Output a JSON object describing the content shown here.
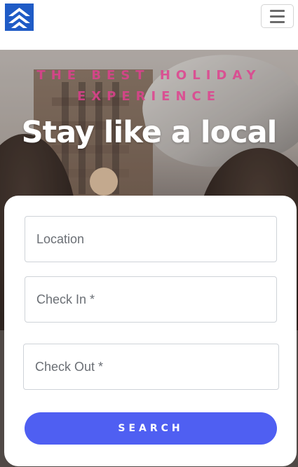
{
  "header": {
    "logo_icon": "brand-chevrons-icon",
    "brand_color": "#1f5bc6",
    "menu_icon": "hamburger-icon"
  },
  "hero": {
    "subtitle_line1": "THE BEST HOLIDAY",
    "subtitle_line2": "EXPERIENCE",
    "title": "Stay like a local",
    "subtitle_color": "#e0418f"
  },
  "form": {
    "location_placeholder": "Location",
    "checkin_placeholder": "Check In *",
    "checkout_placeholder": "Check Out *",
    "search_label": "SEARCH",
    "button_color": "#4f5ff2"
  }
}
